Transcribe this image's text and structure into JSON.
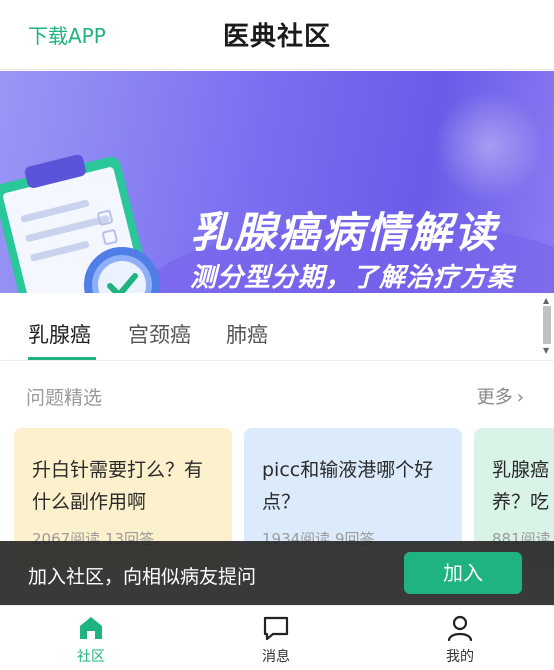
{
  "header": {
    "download_link": "下载APP",
    "title": "医典社区"
  },
  "banner": {
    "headline": "乳腺癌病情解读",
    "subline": "测分型分期，了解治疗方案"
  },
  "tabs": [
    {
      "label": "乳腺癌",
      "active": true
    },
    {
      "label": "宫颈癌",
      "active": false
    },
    {
      "label": "肺癌",
      "active": false
    }
  ],
  "section": {
    "title": "问题精选",
    "more_label": "更多"
  },
  "cards": [
    {
      "question": "升白针需要打么？有什么副作用啊",
      "meta": "2067阅读 13回答"
    },
    {
      "question": "picc和输液港哪个好点？",
      "meta": "1934阅读 9回答"
    },
    {
      "question": "乳腺癌养？吃",
      "meta": "881阅读"
    }
  ],
  "join_bar": {
    "text": "加入社区，向相似病友提问",
    "button_label": "加入"
  },
  "bottom_nav": [
    {
      "label": "社区",
      "icon": "home-icon",
      "active": true
    },
    {
      "label": "消息",
      "icon": "message-icon",
      "active": false
    },
    {
      "label": "我的",
      "icon": "profile-icon",
      "active": false
    }
  ],
  "colors": {
    "accent": "#1fb37f",
    "banner_start": "#9a97f5",
    "banner_end": "#6a5ce8"
  }
}
